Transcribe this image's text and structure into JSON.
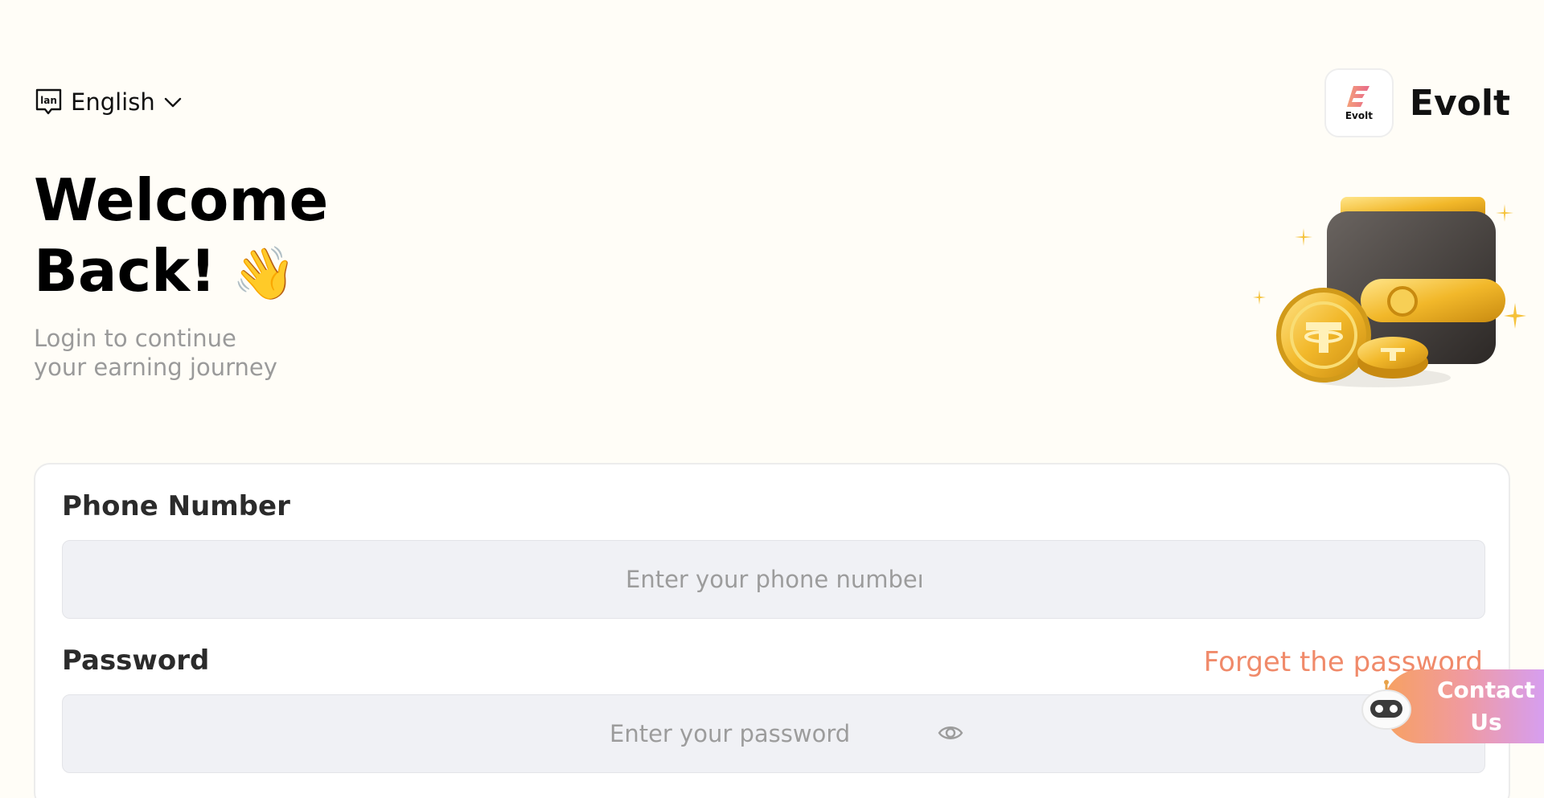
{
  "language": {
    "label": "English",
    "icon": "language-icon"
  },
  "brand": {
    "name": "Evolt",
    "logo_text": "Evolt",
    "logo_color": "#e86a8a"
  },
  "hero": {
    "title_line1": "Welcome",
    "title_line2": "Back!",
    "wave_emoji": "👋",
    "subtitle_line1": "Login to continue",
    "subtitle_line2": "your earning journey"
  },
  "form": {
    "phone_label": "Phone Number",
    "phone_placeholder": "Enter your phone number",
    "password_label": "Password",
    "password_placeholder": "Enter your password",
    "forget_link": "Forget the password"
  },
  "contact": {
    "line1": "Contact",
    "line2": "Us"
  },
  "colors": {
    "background": "#fffdf7",
    "accent_link": "#f08a6a",
    "field_bg": "#f0f1f5",
    "contact_gradient_start": "#f7a15f",
    "contact_gradient_end": "#d69ef0"
  }
}
